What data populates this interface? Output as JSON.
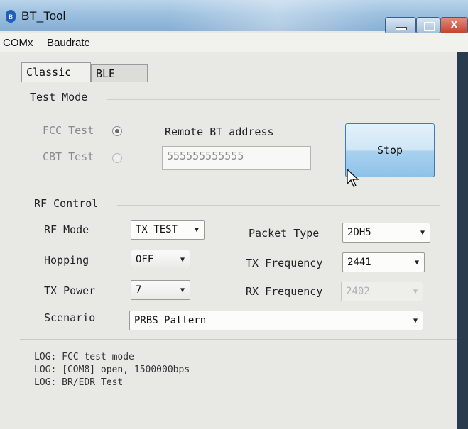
{
  "window": {
    "title": "BT_Tool",
    "app_icon": "bluetooth-icon",
    "close_glyph": "X"
  },
  "menu": [
    "COMx",
    "Baudrate"
  ],
  "tabs": [
    {
      "label": "Classic",
      "selected": true
    },
    {
      "label": "BLE",
      "selected": false
    }
  ],
  "test_mode": {
    "title": "Test Mode",
    "fcc_label": "FCC Test",
    "cbt_label": "CBT Test",
    "selected": "FCC Test",
    "remote_label": "Remote BT address",
    "remote_value": "555555555555",
    "stop_label": "Stop"
  },
  "rf": {
    "title": "RF Control",
    "rf_mode_label": "RF Mode",
    "rf_mode_value": "TX TEST",
    "hopping_label": "Hopping",
    "hopping_value": "OFF",
    "tx_power_label": "TX Power",
    "tx_power_value": "7",
    "scenario_label": "Scenario",
    "scenario_value": "PRBS Pattern",
    "packet_type_label": "Packet Type",
    "packet_type_value": "2DH5",
    "tx_freq_label": "TX Frequency",
    "tx_freq_value": "2441",
    "rx_freq_label": "RX Frequency",
    "rx_freq_value": "2402"
  },
  "log": [
    "LOG: FCC test mode",
    "LOG: [COM8] open, 1500000bps",
    "LOG: BR/EDR Test"
  ]
}
